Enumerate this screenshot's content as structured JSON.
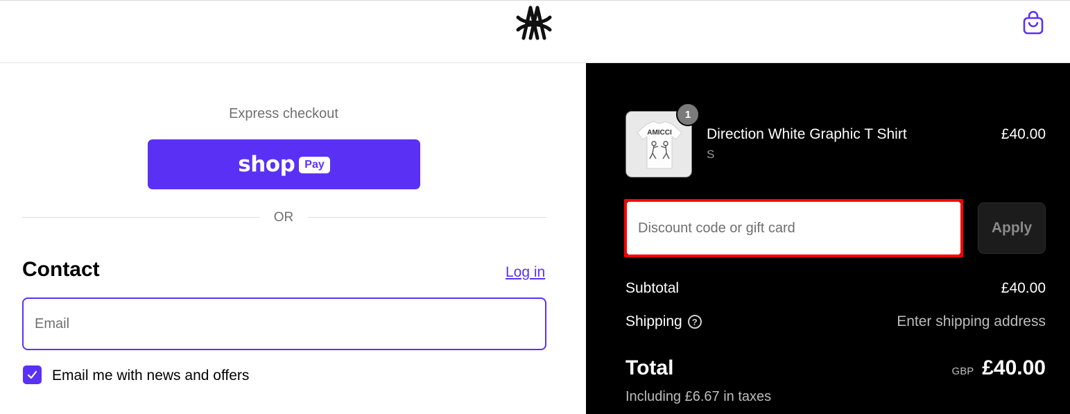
{
  "header": {
    "logo_icon": "amicci-monogram-logo",
    "cart_icon": "shopping-bag-icon",
    "accent_color": "#5a31f4"
  },
  "express": {
    "title": "Express checkout",
    "shop_pay_word": "shop",
    "shop_pay_pill": "Pay",
    "or_label": "OR"
  },
  "contact": {
    "heading": "Contact",
    "login_link": "Log in",
    "email_placeholder": "Email",
    "email_value": "",
    "newsletter_label": "Email me with news and offers",
    "newsletter_checked": true
  },
  "summary": {
    "item": {
      "name": "Direction White Graphic T Shirt",
      "variant": "S",
      "price": "£40.00",
      "quantity": "1",
      "thumbnail_text": "AMICCI"
    },
    "discount": {
      "placeholder": "Discount code or gift card",
      "apply_label": "Apply"
    },
    "subtotal_label": "Subtotal",
    "subtotal_value": "£40.00",
    "shipping_label": "Shipping",
    "shipping_value": "Enter shipping address",
    "total_label": "Total",
    "total_currency": "GBP",
    "total_value": "£40.00",
    "taxes_note": "Including £6.67 in taxes"
  }
}
